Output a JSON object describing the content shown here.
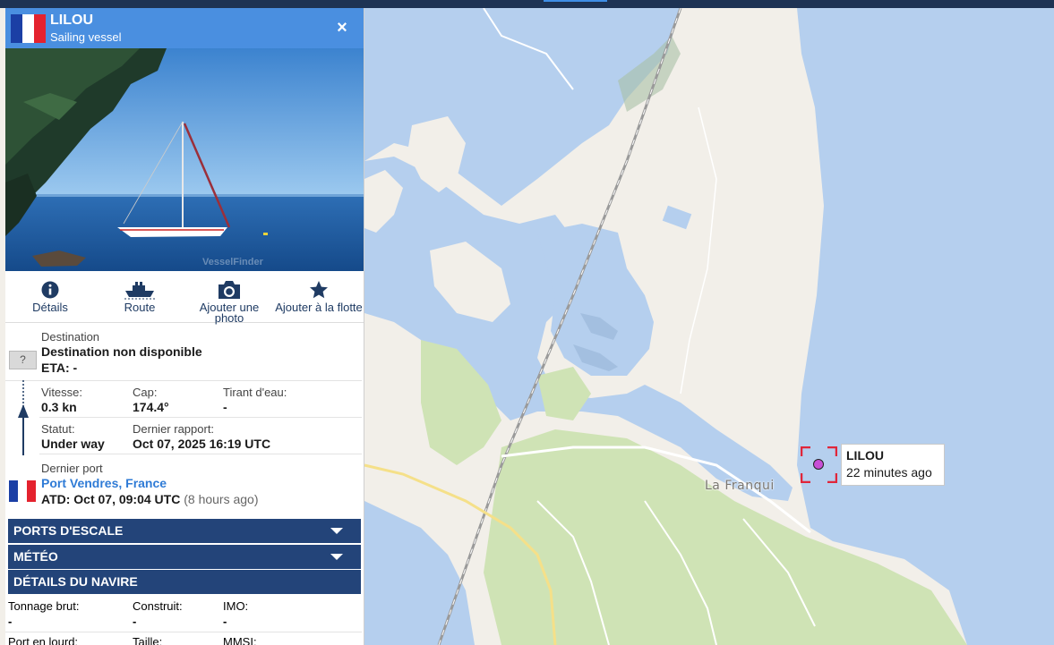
{
  "vessel": {
    "name": "LILOU",
    "type": "Sailing vessel",
    "flag_colors": [
      "#1b3fa5",
      "#ffffff",
      "#e4222e"
    ]
  },
  "header": {
    "close_icon": "×"
  },
  "photo": {
    "watermark": "VesselFinder"
  },
  "actions": [
    {
      "label": "Détails",
      "icon": "info-icon"
    },
    {
      "label": "Route",
      "icon": "ship-route-icon"
    },
    {
      "label": "Ajouter une photo",
      "icon": "camera-icon"
    },
    {
      "label": "Ajouter à la flotte",
      "icon": "star-icon"
    }
  ],
  "destination": {
    "label": "Destination",
    "value": "Destination non disponible",
    "eta": "ETA: -",
    "unknown_icon": "?"
  },
  "speed": {
    "label": "Vitesse:",
    "value": "0.3 kn"
  },
  "course": {
    "label": "Cap:",
    "value": "174.4°"
  },
  "draught": {
    "label": "Tirant d'eau:",
    "value": "-"
  },
  "status": {
    "label": "Statut:",
    "value": "Under way"
  },
  "last_report": {
    "label": "Dernier rapport:",
    "value": "Oct 07, 2025 16:19 UTC"
  },
  "last_port": {
    "label": "Dernier port",
    "name": "Port Vendres, France",
    "atd": "ATD: Oct 07, 09:04 UTC",
    "ago": "(8 hours ago)"
  },
  "sections": {
    "ports": "PORTS D'ESCALE",
    "meteo": "MÉTÉO",
    "details": "DÉTAILS DU NAVIRE"
  },
  "ship_details": [
    {
      "label": "Tonnage brut:",
      "value": "-"
    },
    {
      "label": "Construit:",
      "value": "-"
    },
    {
      "label": "IMO:",
      "value": "-"
    },
    {
      "label": "Port en lourd:",
      "value": ""
    },
    {
      "label": "Taille:",
      "value": ""
    },
    {
      "label": "MMSI:",
      "value": ""
    }
  ],
  "map": {
    "town_label": "La Franqui",
    "tooltip": {
      "name": "LILOU",
      "age": "22 minutes ago"
    },
    "colors": {
      "sea": "#b5cfee",
      "land": "#f2efe9",
      "green": "#cfe3b5",
      "marker": "#e0263a",
      "vessel_dot": "#c84fd6"
    }
  }
}
